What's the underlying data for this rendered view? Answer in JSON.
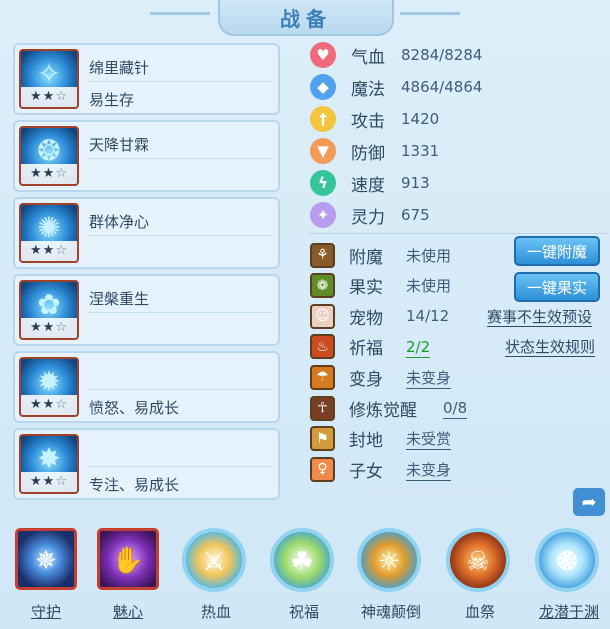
{
  "window": {
    "title": "战备"
  },
  "skills": [
    {
      "name": "绵里藏针",
      "desc": "易生存",
      "stars_filled": 2,
      "stars_total": 3,
      "icon": "needle-skill-icon"
    },
    {
      "name": "天降甘霖",
      "desc": "",
      "stars_filled": 2,
      "stars_total": 3,
      "icon": "rain-skill-icon"
    },
    {
      "name": "群体净心",
      "desc": "",
      "stars_filled": 2,
      "stars_total": 3,
      "icon": "purify-skill-icon"
    },
    {
      "name": "涅槃重生",
      "desc": "",
      "stars_filled": 2,
      "stars_total": 3,
      "icon": "rebirth-skill-icon"
    },
    {
      "name": "",
      "desc": "愤怒、易成长",
      "stars_filled": 2,
      "stars_total": 3,
      "icon": "rage-skill-icon"
    },
    {
      "name": "",
      "desc": "专注、易成长",
      "stars_filled": 2,
      "stars_total": 3,
      "icon": "focus-skill-icon"
    }
  ],
  "stats": [
    {
      "label": "气血",
      "value": "8284/8284",
      "icon": "heart-icon",
      "color": "#ef6b7c"
    },
    {
      "label": "魔法",
      "value": "4864/4864",
      "icon": "diamond-icon",
      "color": "#4ea3ec"
    },
    {
      "label": "攻击",
      "value": "1420",
      "icon": "sword-icon",
      "color": "#f2c440"
    },
    {
      "label": "防御",
      "value": "1331",
      "icon": "shield-icon",
      "color": "#f29a57"
    },
    {
      "label": "速度",
      "value": "913",
      "icon": "lightning-icon",
      "color": "#36c59b"
    },
    {
      "label": "灵力",
      "value": "675",
      "icon": "sparkle-icon",
      "color": "#b79cf0"
    }
  ],
  "buffs": [
    {
      "label": "附魔",
      "value": "未使用",
      "icon": "enchant-icon",
      "bg": "#8a5b2a"
    },
    {
      "label": "果实",
      "value": "未使用",
      "icon": "fruit-icon",
      "bg": "#5f8d2a"
    },
    {
      "label": "宠物",
      "value": "14/12",
      "icon": "pet-portrait-icon",
      "bg": "#e9d0c3"
    },
    {
      "label": "祈福",
      "value": "2/2",
      "icon": "pray-icon",
      "bg": "#c94b1f"
    },
    {
      "label": "变身",
      "value": "未变身",
      "icon": "transform-icon",
      "bg": "#d77a1f"
    },
    {
      "label": "修炼觉醒",
      "value": "0/8",
      "icon": "meditation-icon",
      "bg": "#7a3e25"
    },
    {
      "label": "封地",
      "value": "未受赏",
      "icon": "fief-icon",
      "bg": "#d19a3a"
    },
    {
      "label": "子女",
      "value": "未变身",
      "icon": "child-icon",
      "bg": "#f08a4a"
    }
  ],
  "buttons": {
    "enchant": "一键附魔",
    "fruit": "一键果实",
    "preset": "赛事不生效预设",
    "rules": "状态生效规则"
  },
  "dock": [
    {
      "label": "守护",
      "icon": "guard-orb-icon",
      "style": "square",
      "underline": true
    },
    {
      "label": "魅心",
      "icon": "charm-hand-icon",
      "style": "square",
      "underline": true
    },
    {
      "label": "热血",
      "icon": "hot-blood-icon",
      "style": "round",
      "underline": false
    },
    {
      "label": "祝福",
      "icon": "blessing-icon",
      "style": "round",
      "underline": false
    },
    {
      "label": "神魂颠倒",
      "icon": "soul-swap-icon",
      "style": "round",
      "underline": false
    },
    {
      "label": "血祭",
      "icon": "blood-sacrifice-icon",
      "style": "round",
      "underline": false
    },
    {
      "label": "龙潜于渊",
      "icon": "dragon-abyss-icon",
      "style": "round",
      "underline": true
    }
  ],
  "share": {
    "icon": "share-icon"
  }
}
